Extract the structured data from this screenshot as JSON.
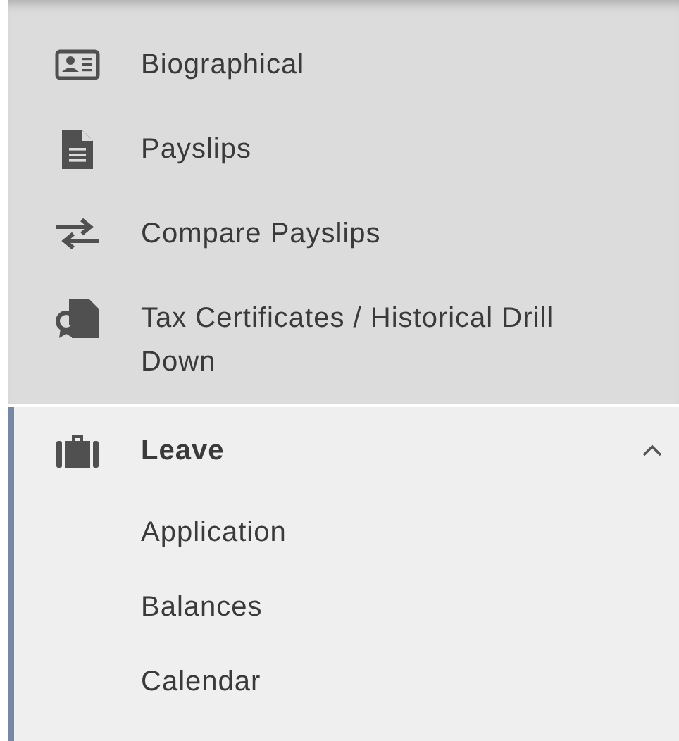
{
  "menu_items": [
    {
      "label": "Biographical"
    },
    {
      "label": "Payslips"
    },
    {
      "label": "Compare Payslips"
    },
    {
      "label": "Tax Certificates / Historical Drill Down"
    }
  ],
  "leave_group": {
    "label": "Leave",
    "expanded": true,
    "selected": true,
    "children": [
      {
        "label": "Application"
      },
      {
        "label": "Balances"
      },
      {
        "label": "Calendar"
      }
    ]
  }
}
